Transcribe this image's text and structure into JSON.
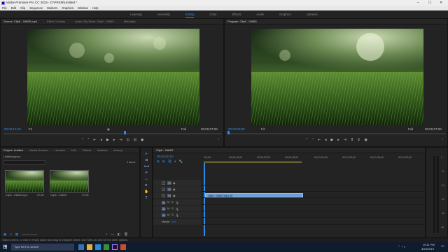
{
  "titlebar": {
    "title": "Adobe Premiere Pro CC 2019 - D:\\PREM\\Untitled *",
    "minimize": "–",
    "maximize": "☐",
    "close": "✕"
  },
  "menu": [
    "File",
    "Edit",
    "Clip",
    "Sequence",
    "Markers",
    "Graphics",
    "Window",
    "Help"
  ],
  "workspaces": {
    "items": [
      "Learning",
      "Assembly",
      "Editing",
      "Color",
      "Effects",
      "Audio",
      "Graphics",
      "Libraries"
    ],
    "active": "Editing"
  },
  "source_monitor": {
    "tabs": [
      "Source: Clip6 - 0465S.mp4",
      "Effect Controls",
      "Audio Clip Mixer: Clip6 - 0465S",
      "Metadata"
    ],
    "timecode": "00;00;12;19",
    "fit": "Fit",
    "duration": "00;00;27;08",
    "zoom": "Full"
  },
  "program_monitor": {
    "tabs": [
      "Program: Clip6 - 0465S"
    ],
    "timecode": "00;00;00;00",
    "fit": "Fit",
    "duration": "00;00;27;08",
    "zoom": "Full"
  },
  "project_panel": {
    "tabs": [
      "Project: Untitled",
      "Media Browser",
      "Libraries",
      "Info",
      "Effects",
      "Markers",
      "History"
    ],
    "project_file": "Untitled.prproj",
    "item_count": "2 Items",
    "items": [
      {
        "name": "Clip6 - 0465S.mp4",
        "duration": "27;08"
      },
      {
        "name": "Clip6 - 0465S",
        "duration": "27;08"
      }
    ]
  },
  "timeline": {
    "tab": "Clip6 - 0465S",
    "timecode": "00;00;00;00",
    "ruler": [
      ";00;00",
      "00;00;16;00",
      "00;00;32;00",
      "00;00;48;00",
      "00;01;04;00",
      "00;01;20;00",
      "00;01;36;00",
      "00;01;52;00"
    ],
    "video_tracks": [
      "V3",
      "V2",
      "V1"
    ],
    "audio_tracks": [
      "A1",
      "A2",
      "A3"
    ],
    "master": "Master",
    "master_value": "0.0",
    "clip_label": "Clip6 - 0465S.mp4 [V]"
  },
  "audio_meter": {
    "scale": [
      "0",
      "-12",
      "-24",
      "-36",
      "-48",
      "dB"
    ]
  },
  "statusbar": "Click to select, or click in empty space and drag to marquee select. Use Shift, Alt, and Ctrl for other options.",
  "taskbar": {
    "search_placeholder": "Type here to search",
    "time": "10:11 PM",
    "date": "3/29/2019"
  },
  "colors": {
    "accent": "#2d8ceb",
    "clip": "#6a9fd8",
    "workarea": "#e8d94a"
  }
}
